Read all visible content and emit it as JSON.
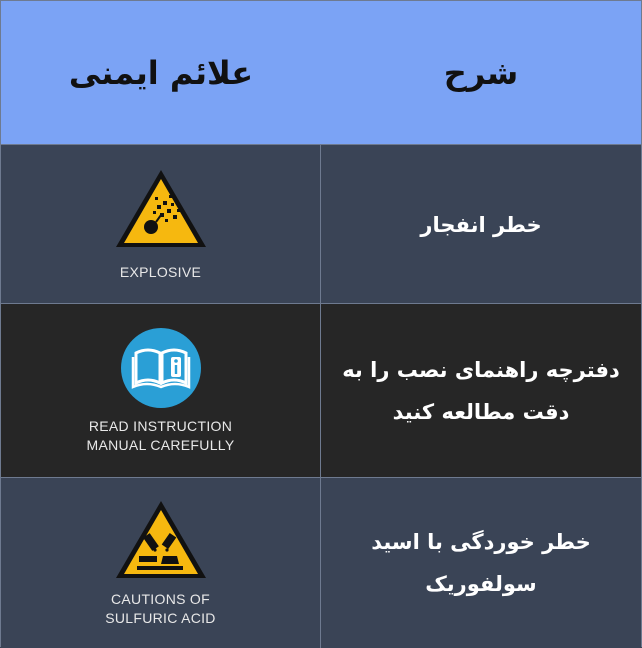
{
  "header": {
    "col_left": "علائم ایمنی",
    "col_right": "شرح"
  },
  "rows": [
    {
      "icon": "explosive-warning-icon",
      "caption_line1": "EXPLOSIVE",
      "caption_line2": "",
      "description_line1": "خطر انفجار",
      "description_line2": ""
    },
    {
      "icon": "read-manual-icon",
      "caption_line1": "READ INSTRUCTION",
      "caption_line2": "MANUAL CAREFULLY",
      "description_line1": "دفترچه راهنمای نصب را به",
      "description_line2": "دقت مطالعه کنید"
    },
    {
      "icon": "corrosive-warning-icon",
      "caption_line1": "CAUTIONS OF",
      "caption_line2": "SULFURIC ACID",
      "description_line1": "خطر خوردگی با اسید",
      "description_line2": "سولفوریک"
    }
  ],
  "colors": {
    "header_bg": "#7ba3f5",
    "row_bg": "#3a4456",
    "row_alt_bg": "#262626",
    "warning_yellow": "#f6b80f",
    "info_blue": "#2a9fd6"
  }
}
